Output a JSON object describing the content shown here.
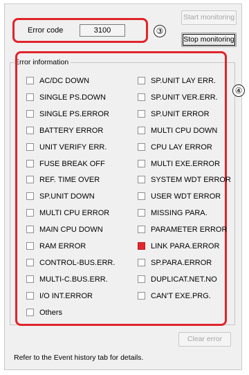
{
  "error": {
    "label": "Error code",
    "value": "3100"
  },
  "buttons": {
    "start": "Start monitoring",
    "stop": "Stop monitoring",
    "clear": "Clear error"
  },
  "callouts": [
    "③",
    "④"
  ],
  "group": {
    "title": "Error information",
    "left_items": [
      {
        "label": "AC/DC DOWN",
        "checked": false
      },
      {
        "label": "SINGLE PS.DOWN",
        "checked": false
      },
      {
        "label": "SINGLE PS.ERROR",
        "checked": false
      },
      {
        "label": "BATTERY ERROR",
        "checked": false
      },
      {
        "label": "UNIT VERIFY ERR.",
        "checked": false
      },
      {
        "label": "FUSE BREAK OFF",
        "checked": false
      },
      {
        "label": "REF. TIME OVER",
        "checked": false
      },
      {
        "label": "SP.UNIT DOWN",
        "checked": false
      },
      {
        "label": "MULTI CPU ERROR",
        "checked": false
      },
      {
        "label": "MAIN CPU DOWN",
        "checked": false
      },
      {
        "label": "RAM ERROR",
        "checked": false
      },
      {
        "label": "CONTROL-BUS.ERR.",
        "checked": false
      },
      {
        "label": "MULTI-C.BUS.ERR.",
        "checked": false
      },
      {
        "label": "I/O INT.ERROR",
        "checked": false
      },
      {
        "label": "Others",
        "checked": false
      }
    ],
    "right_items": [
      {
        "label": "SP.UNIT LAY ERR.",
        "checked": false
      },
      {
        "label": "SP.UNIT VER.ERR.",
        "checked": false
      },
      {
        "label": "SP.UNIT ERROR",
        "checked": false
      },
      {
        "label": "MULTI CPU DOWN",
        "checked": false
      },
      {
        "label": "CPU LAY ERROR",
        "checked": false
      },
      {
        "label": "MULTI EXE.ERROR",
        "checked": false
      },
      {
        "label": "SYSTEM WDT ERROR",
        "checked": false
      },
      {
        "label": "USER WDT ERROR",
        "checked": false
      },
      {
        "label": "MISSING PARA.",
        "checked": false
      },
      {
        "label": "PARAMETER ERROR",
        "checked": false
      },
      {
        "label": "LINK PARA.ERROR",
        "checked": true
      },
      {
        "label": "SP.PARA.ERROR",
        "checked": false
      },
      {
        "label": "DUPLICAT.NET.NO",
        "checked": false
      },
      {
        "label": "CAN'T EXE.PRG.",
        "checked": false
      }
    ]
  },
  "footer": "Refer to the Event history tab for details.",
  "colors": {
    "highlight": "#e0242c",
    "active_check": "#e3262d"
  }
}
